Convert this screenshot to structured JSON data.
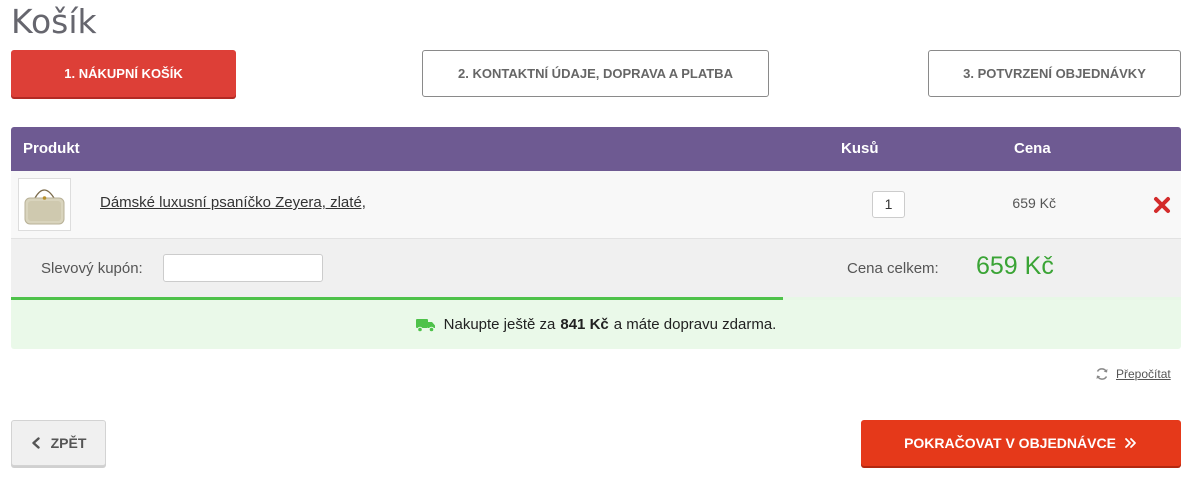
{
  "page": {
    "title": "Košík"
  },
  "steps": [
    {
      "label": "1. Nákupní košík",
      "active": true
    },
    {
      "label": "2. Kontaktní údaje, doprava a platba",
      "active": false
    },
    {
      "label": "3. Potvrzení objednávky",
      "active": false
    }
  ],
  "cart": {
    "headers": {
      "product": "Produkt",
      "qty": "Kusů",
      "price": "Cena"
    },
    "items": [
      {
        "name": "Dámské luxusní psaníčko Zeyera, zlaté,",
        "qty": "1",
        "price": "659 Kč",
        "image_icon": "handbag-icon"
      }
    ]
  },
  "summary": {
    "coupon_label": "Slevový kupón:",
    "coupon_value": "",
    "total_label": "Cena celkem:",
    "total_value": "659 Kč"
  },
  "shipping": {
    "text_before": "Nakupte ještě za",
    "amount": "841 Kč",
    "text_after": "a máte dopravu zdarma.",
    "progress_fraction": 0.66
  },
  "actions": {
    "recalculate": "Přepočítat",
    "back": "ZPĚT",
    "continue": "POKRAČOVAT V OBJEDNÁVCE"
  },
  "colors": {
    "accent_red": "#dd3f37",
    "header_purple": "#6e5a92",
    "total_green": "#3aa435",
    "continue_orange": "#e5391a"
  }
}
